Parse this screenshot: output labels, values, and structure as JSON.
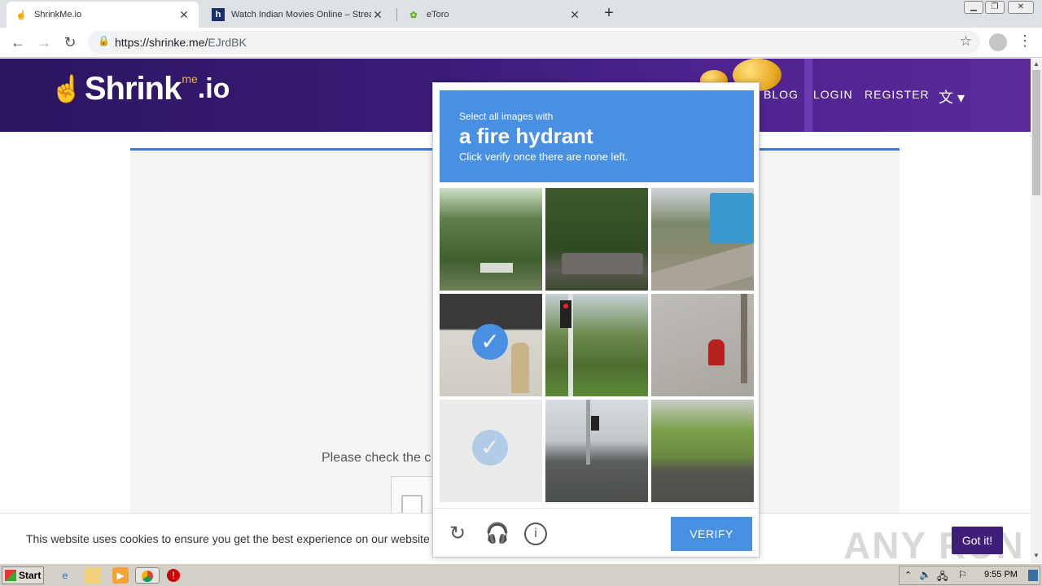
{
  "browser": {
    "tabs": [
      {
        "title": "ShrinkMe.io",
        "active": true
      },
      {
        "title": "Watch Indian Movies Online – Stream",
        "active": false
      },
      {
        "title": "eToro",
        "active": false
      }
    ],
    "address": {
      "host": "https://shrinke.me/",
      "path": "EJrdBK"
    }
  },
  "site": {
    "logo": {
      "brand": "Shrink",
      "me": "me",
      "tld": ".io"
    },
    "nav": {
      "blog": "BLOG",
      "login": "LOGIN",
      "register": "REGISTER"
    },
    "check_text": "Please check the c"
  },
  "captcha": {
    "header_small": "Select all images with",
    "header_big": "a fire hydrant",
    "header_note": "Click verify once there are none left.",
    "tiles": [
      {
        "subject": "trees",
        "selected": false
      },
      {
        "subject": "debris-in-grass",
        "selected": false
      },
      {
        "subject": "street-with-truck",
        "selected": false
      },
      {
        "subject": "fire-hydrant-sidewalk",
        "selected": true
      },
      {
        "subject": "traffic-light",
        "selected": false
      },
      {
        "subject": "red-fire-hydrant",
        "selected": false
      },
      {
        "subject": "faded-tile",
        "selected": true
      },
      {
        "subject": "intersection",
        "selected": false
      },
      {
        "subject": "road",
        "selected": false
      }
    ],
    "verify_label": "VERIFY"
  },
  "cookie": {
    "text": "This website uses cookies to ensure you get the best experience on our website",
    "button": "Got it!"
  },
  "watermark": "ANY RUN",
  "taskbar": {
    "start": "Start",
    "clock": "9:55 PM"
  }
}
